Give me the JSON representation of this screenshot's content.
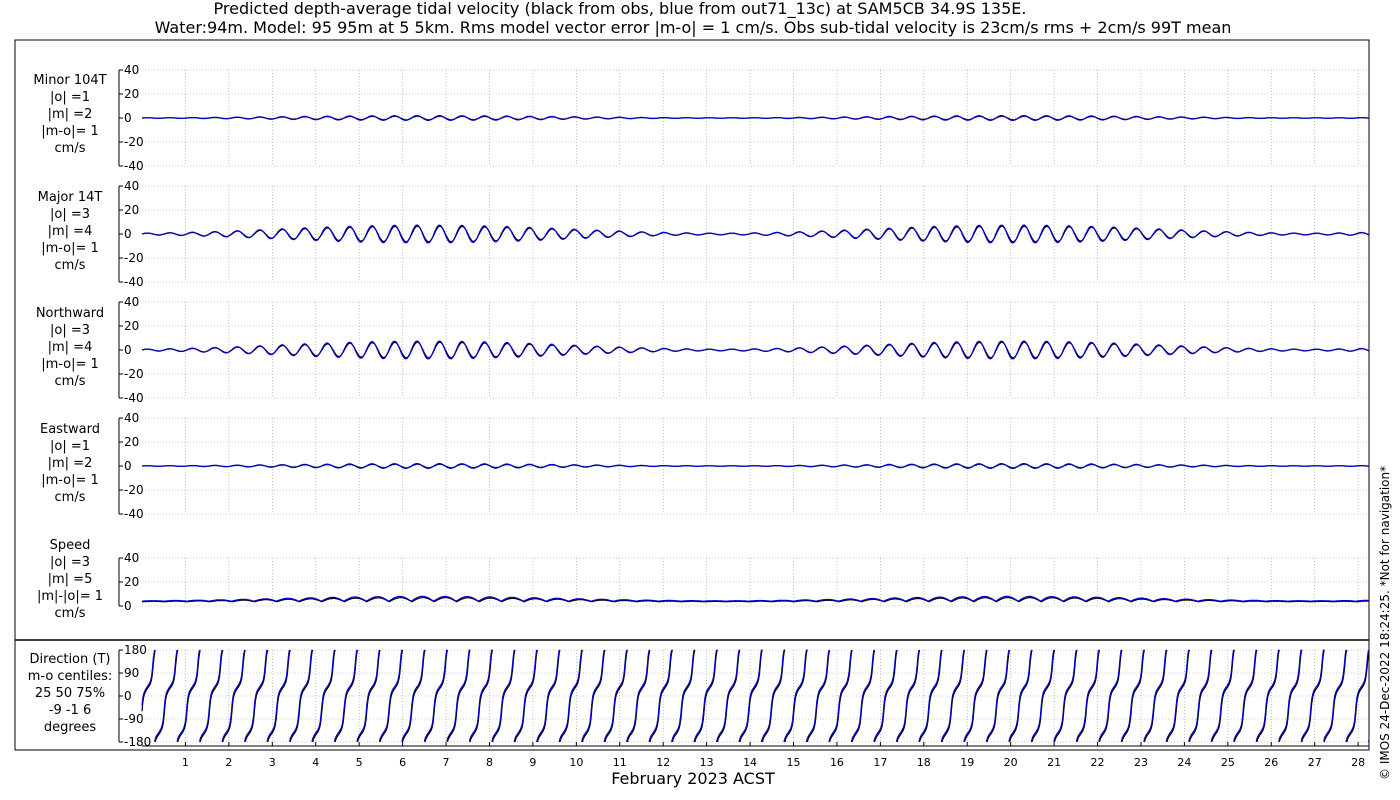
{
  "title_line1": "Predicted depth-average tidal velocity (black from obs, blue from out71_13c) at SAM5CB 34.9S 135E.",
  "title_line2": "Water:94m. Model: 95 95m at 5 5km. Rms model vector error |m-o| = 1 cm/s. Obs sub-tidal velocity is 23cm/s rms + 2cm/s 99T mean",
  "xlabel": "February 2023 ACST",
  "credit": "© IMOS 24-Dec-2022 18:24:25. *Not for navigation*",
  "colors": {
    "obs": "#000000",
    "model": "#0000cc",
    "grid": "#999999"
  },
  "chart_data": [
    {
      "type": "line",
      "name": "minor",
      "labels": [
        "Minor 104T",
        "|o| =1",
        "|m| =2",
        "|m-o|= 1",
        "cm/s"
      ],
      "yticks": [
        40,
        20,
        0,
        -20,
        -40
      ],
      "ylim": [
        -40,
        40
      ],
      "xlim": [
        0,
        28.25
      ],
      "series": [
        {
          "amplitude": 1.5,
          "offset": 0
        },
        {
          "amplitude": 2.0,
          "offset": 0
        }
      ]
    },
    {
      "type": "line",
      "name": "major",
      "labels": [
        "Major 14T",
        "|o| =3",
        "|m| =4",
        "|m-o|= 1",
        "cm/s"
      ],
      "yticks": [
        40,
        20,
        0,
        -20,
        -40
      ],
      "ylim": [
        -40,
        40
      ],
      "xlim": [
        0,
        28.25
      ],
      "series": [
        {
          "amplitude": 6.5,
          "offset": 0
        },
        {
          "amplitude": 7.5,
          "offset": 0
        }
      ]
    },
    {
      "type": "line",
      "name": "northward",
      "labels": [
        "Northward",
        "|o| =3",
        "|m| =4",
        "|m-o|= 1",
        "cm/s"
      ],
      "yticks": [
        40,
        20,
        0,
        -20,
        -40
      ],
      "ylim": [
        -40,
        40
      ],
      "xlim": [
        0,
        28.25
      ],
      "series": [
        {
          "amplitude": 6.5,
          "offset": 0
        },
        {
          "amplitude": 7.5,
          "offset": 0
        }
      ]
    },
    {
      "type": "line",
      "name": "eastward",
      "labels": [
        "Eastward",
        "|o| =1",
        "|m| =2",
        "|m-o|= 1",
        "cm/s"
      ],
      "yticks": [
        40,
        20,
        0,
        -20,
        -40
      ],
      "ylim": [
        -40,
        40
      ],
      "xlim": [
        0,
        28.25
      ],
      "series": [
        {
          "amplitude": 1.5,
          "offset": 0
        },
        {
          "amplitude": 2.0,
          "offset": 0
        }
      ]
    },
    {
      "type": "line",
      "name": "speed",
      "labels": [
        "Speed",
        "|o| =3",
        "|m| =5",
        "|m|-|o|= 1",
        "cm/s"
      ],
      "yticks": [
        40,
        20,
        0
      ],
      "ylim": [
        0,
        40
      ],
      "xlim": [
        0,
        28.25
      ],
      "series": [
        {
          "amplitude": 3.5,
          "offset": 3.5
        },
        {
          "amplitude": 4.0,
          "offset": 4.0
        }
      ]
    },
    {
      "type": "line",
      "name": "direction",
      "labels": [
        "Direction (T)",
        "m-o centiles:",
        "25  50  75%",
        "-9 -1  6",
        "degrees"
      ],
      "yticks": [
        180,
        90,
        0,
        -90,
        -180
      ],
      "ylim": [
        -180,
        180
      ],
      "xlim": [
        0,
        28.25
      ],
      "series": [
        {
          "name": "obs"
        },
        {
          "name": "model"
        }
      ]
    }
  ],
  "x_ticks": [
    "1",
    "2",
    "3",
    "4",
    "5",
    "6",
    "7",
    "8",
    "9",
    "10",
    "11",
    "12",
    "13",
    "14",
    "15",
    "16",
    "17",
    "18",
    "19",
    "20",
    "21",
    "22",
    "23",
    "24",
    "25",
    "26",
    "27",
    "28"
  ],
  "x_tick_positions": [
    1,
    2,
    3,
    4,
    5,
    6,
    7,
    8,
    9,
    10,
    11,
    12,
    13,
    14,
    15,
    16,
    17,
    18,
    19,
    20,
    21,
    22,
    23,
    24,
    25,
    26,
    27,
    28
  ]
}
